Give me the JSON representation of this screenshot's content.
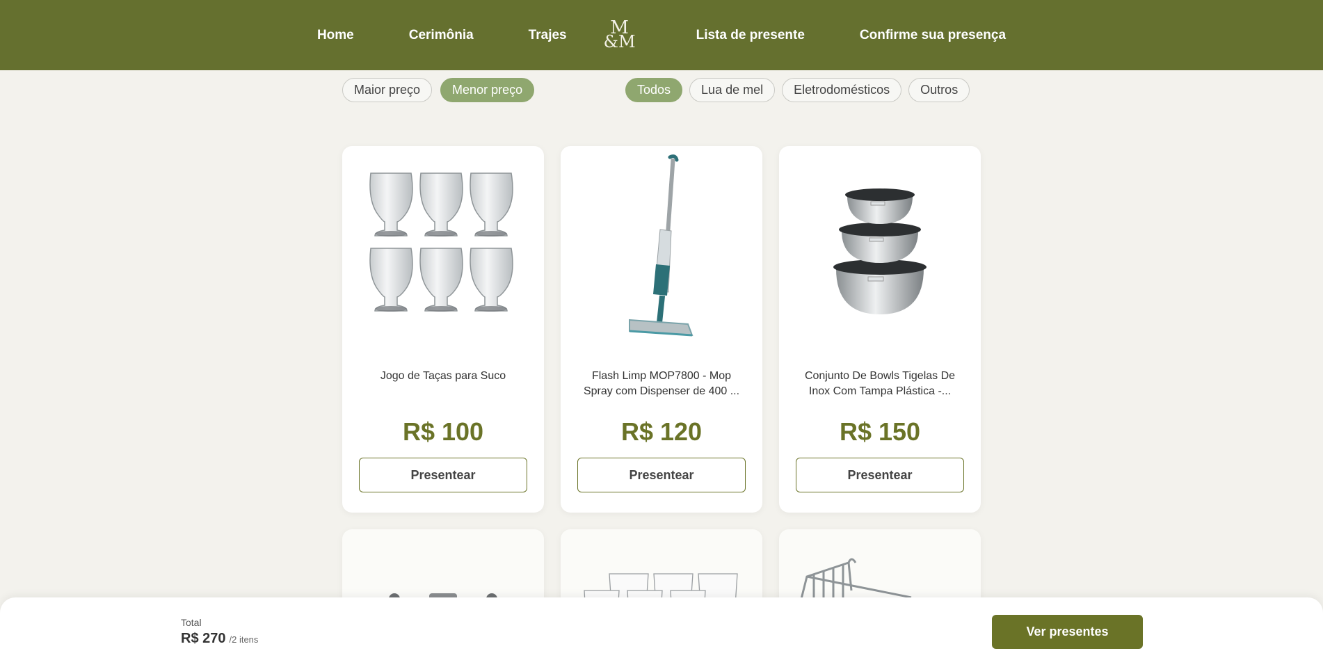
{
  "nav": {
    "links": [
      "Home",
      "Cerimônia",
      "Trajes",
      "Lista de presente",
      "Confirme sua presença"
    ],
    "logo_text": "M&M"
  },
  "sort": {
    "options": [
      "Maior preço",
      "Menor preço"
    ],
    "active": "Menor preço"
  },
  "categories": {
    "options": [
      "Todos",
      "Lua de mel",
      "Eletrodomésticos",
      "Outros"
    ],
    "active": "Todos"
  },
  "products": [
    {
      "title": "Jogo de Taças para Suco",
      "price": "R$ 100",
      "button": "Presentear",
      "icon": "glasses-set-image"
    },
    {
      "title": "Flash Limp MOP7800 - Mop Spray com Dispenser de 400 ...",
      "price": "R$ 120",
      "button": "Presentear",
      "icon": "spray-mop-image"
    },
    {
      "title": "Conjunto De Bowls Tigelas De Inox Com Tampa Plástica -...",
      "price": "R$ 150",
      "button": "Presentear",
      "icon": "steel-bowls-image"
    }
  ],
  "cart": {
    "total_label": "Total",
    "total_value": "R$ 270",
    "count": "/2 itens",
    "button": "Ver presentes"
  }
}
